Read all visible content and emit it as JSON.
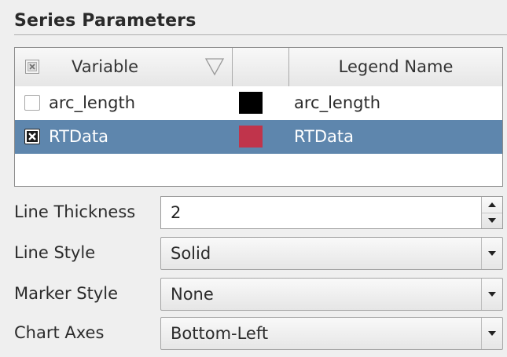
{
  "section": {
    "title": "Series Parameters"
  },
  "table": {
    "headers": {
      "variable": "Variable",
      "color": "",
      "legend_name": "Legend Name"
    },
    "rows": [
      {
        "checked": false,
        "variable": "arc_length",
        "color": "#000000",
        "legend_name": "arc_length",
        "selected": false
      },
      {
        "checked": true,
        "variable": "RTData",
        "color": "#c0344b",
        "legend_name": "RTData",
        "selected": true
      }
    ],
    "selection_color": "#5e86ad"
  },
  "fields": {
    "line_thickness": {
      "label": "Line Thickness",
      "value": "2"
    },
    "line_style": {
      "label": "Line Style",
      "value": "Solid"
    },
    "marker_style": {
      "label": "Marker Style",
      "value": "None"
    },
    "chart_axes": {
      "label": "Chart Axes",
      "value": "Bottom-Left"
    }
  },
  "icons": {
    "header_check": "partial-check-icon",
    "sort": "sort-triangle-icon",
    "spin_up": "arrow-up-icon",
    "spin_down": "arrow-down-icon",
    "dropdown": "chevron-down-icon"
  }
}
